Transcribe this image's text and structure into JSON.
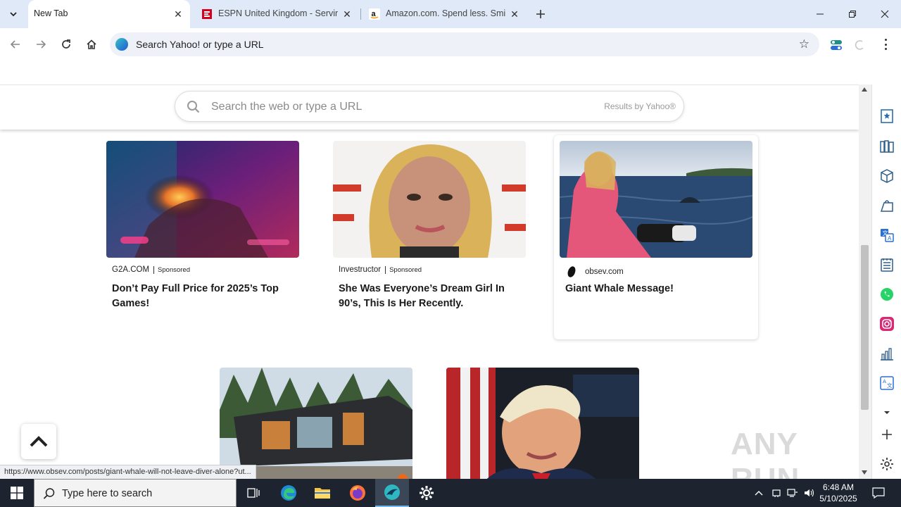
{
  "browser": {
    "tabs": [
      {
        "title": "New Tab",
        "active": true
      },
      {
        "title": "ESPN United Kingdom - Serving",
        "active": false
      },
      {
        "title": "Amazon.com. Spend less. Smile",
        "active": false
      }
    ],
    "omnibox_text": "Search Yahoo! or type a URL"
  },
  "page": {
    "search_placeholder": "Search the web or type a URL",
    "results_by": "Results by Yahoo®",
    "sponsored_label": "Sponsored",
    "cards": [
      {
        "source": "G2A.COM",
        "sponsored": true,
        "headline": "Don’t Pay Full Price for 2025’s Top Games!"
      },
      {
        "source": "Investructor",
        "sponsored": true,
        "headline": "She Was Everyone’s Dream Girl In 90’s, This Is Her Recently."
      },
      {
        "source": "obsev.com",
        "sponsored": false,
        "headline": "Giant Whale Message!"
      }
    ],
    "status_url": "https://www.obsev.com/posts/giant-whale-will-not-leave-diver-alone?ut...",
    "watermark": "ANY RUN"
  },
  "taskbar": {
    "search_placeholder": "Type here to search",
    "time": "6:48 AM",
    "date": "5/10/2025"
  },
  "colors": {
    "tabstrip_bg": "#dfe9f7",
    "taskbar_bg": "#1d2430",
    "instagram": "#d62976",
    "whatsapp": "#25d366"
  }
}
